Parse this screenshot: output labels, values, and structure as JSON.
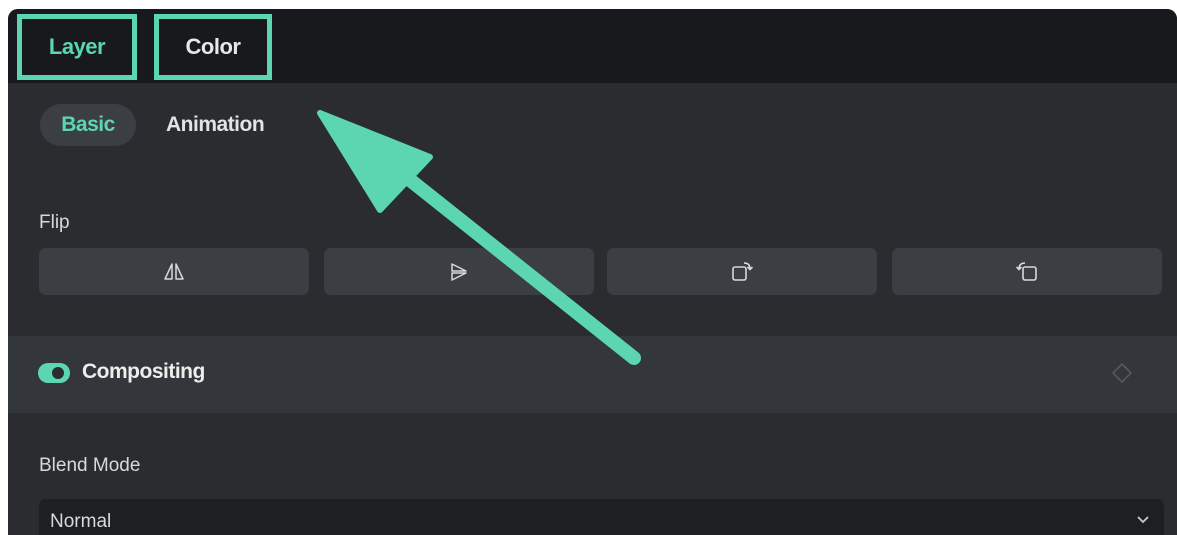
{
  "tabs": {
    "layer": "Layer",
    "color": "Color",
    "active": "layer"
  },
  "subtabs": {
    "basic": "Basic",
    "animation": "Animation",
    "active": "basic"
  },
  "flip": {
    "label": "Flip",
    "buttons": [
      {
        "icon": "flip-horizontal-icon"
      },
      {
        "icon": "flip-vertical-icon"
      },
      {
        "icon": "rotate-clockwise-icon"
      },
      {
        "icon": "rotate-counterclockwise-icon"
      }
    ]
  },
  "compositing": {
    "title": "Compositing",
    "enabled": true,
    "keyframe_icon": "keyframe-diamond-icon"
  },
  "blend_mode": {
    "label": "Blend Mode",
    "value": "Normal",
    "icon": "chevron-down-icon"
  },
  "annotation": {
    "accent_color": "#5cd6b0",
    "arrow_icon": "annotation-arrow"
  },
  "colors": {
    "panel_bg": "#2a2c30",
    "topbar_bg": "#17191c",
    "accent": "#5cd6b0",
    "button_bg": "#3b3e43"
  }
}
